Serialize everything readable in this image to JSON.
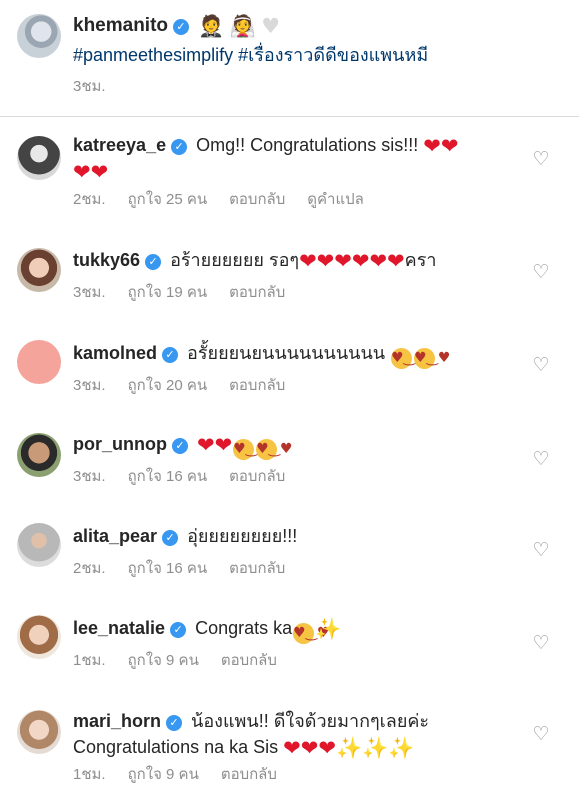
{
  "caption": {
    "username": "khemanito",
    "emojis": [
      "🤵🏻",
      "👰🏻",
      "🤍"
    ],
    "hashtags": "#panmeethesimplify #เรื่องราวดีดีของแพนหมี",
    "time": "3ชม."
  },
  "labels": {
    "likes_prefix": "ถูกใจ",
    "likes_suffix": "คน",
    "reply": "ตอบกลับ",
    "translate": "ดูคำแปล"
  },
  "comments": [
    {
      "username": "katreeya_e",
      "text": "Omg!! Congratulations sis!!!",
      "time": "2ชม.",
      "likes": "ถูกใจ 25 คน",
      "reply": "ตอบกลับ",
      "translate": "ดูคำแปล"
    },
    {
      "username": "tukky66",
      "text": "อร้ายยยยยย รอๆ",
      "text_after": "ครา",
      "time": "3ชม.",
      "likes": "ถูกใจ 19 คน",
      "reply": "ตอบกลับ"
    },
    {
      "username": "kamolned",
      "text": "อรั้ยยยนยนนนนนนนนนน",
      "time": "3ชม.",
      "likes": "ถูกใจ 20 คน",
      "reply": "ตอบกลับ"
    },
    {
      "username": "por_unnop",
      "text": "",
      "time": "3ชม.",
      "likes": "ถูกใจ 16 คน",
      "reply": "ตอบกลับ"
    },
    {
      "username": "alita_pear",
      "text": "อุ่ยยยยยยยย!!!",
      "time": "2ชม.",
      "likes": "ถูกใจ 16 คน",
      "reply": "ตอบกลับ"
    },
    {
      "username": "lee_natalie",
      "text": "Congrats ka",
      "time": "1ชม.",
      "likes": "ถูกใจ 9 คน",
      "reply": "ตอบกลับ"
    },
    {
      "username": "mari_horn",
      "text": "น้องแพน!! ดีใจด้วยมากๆเลยค่ะ",
      "text_line2": "Congratulations na ka Sis",
      "time": "1ชม.",
      "likes": "ถูกใจ 9 คน",
      "reply": "ตอบกลับ"
    }
  ],
  "icons": {
    "verified": "verified-badge-icon",
    "like": "heart-outline-icon"
  },
  "colors": {
    "verified": "#3897f0",
    "meta": "#8e8e8e",
    "hashtag": "#00376b",
    "heart": "#e0162b",
    "kamolned_avatar": "#f4a49b"
  }
}
